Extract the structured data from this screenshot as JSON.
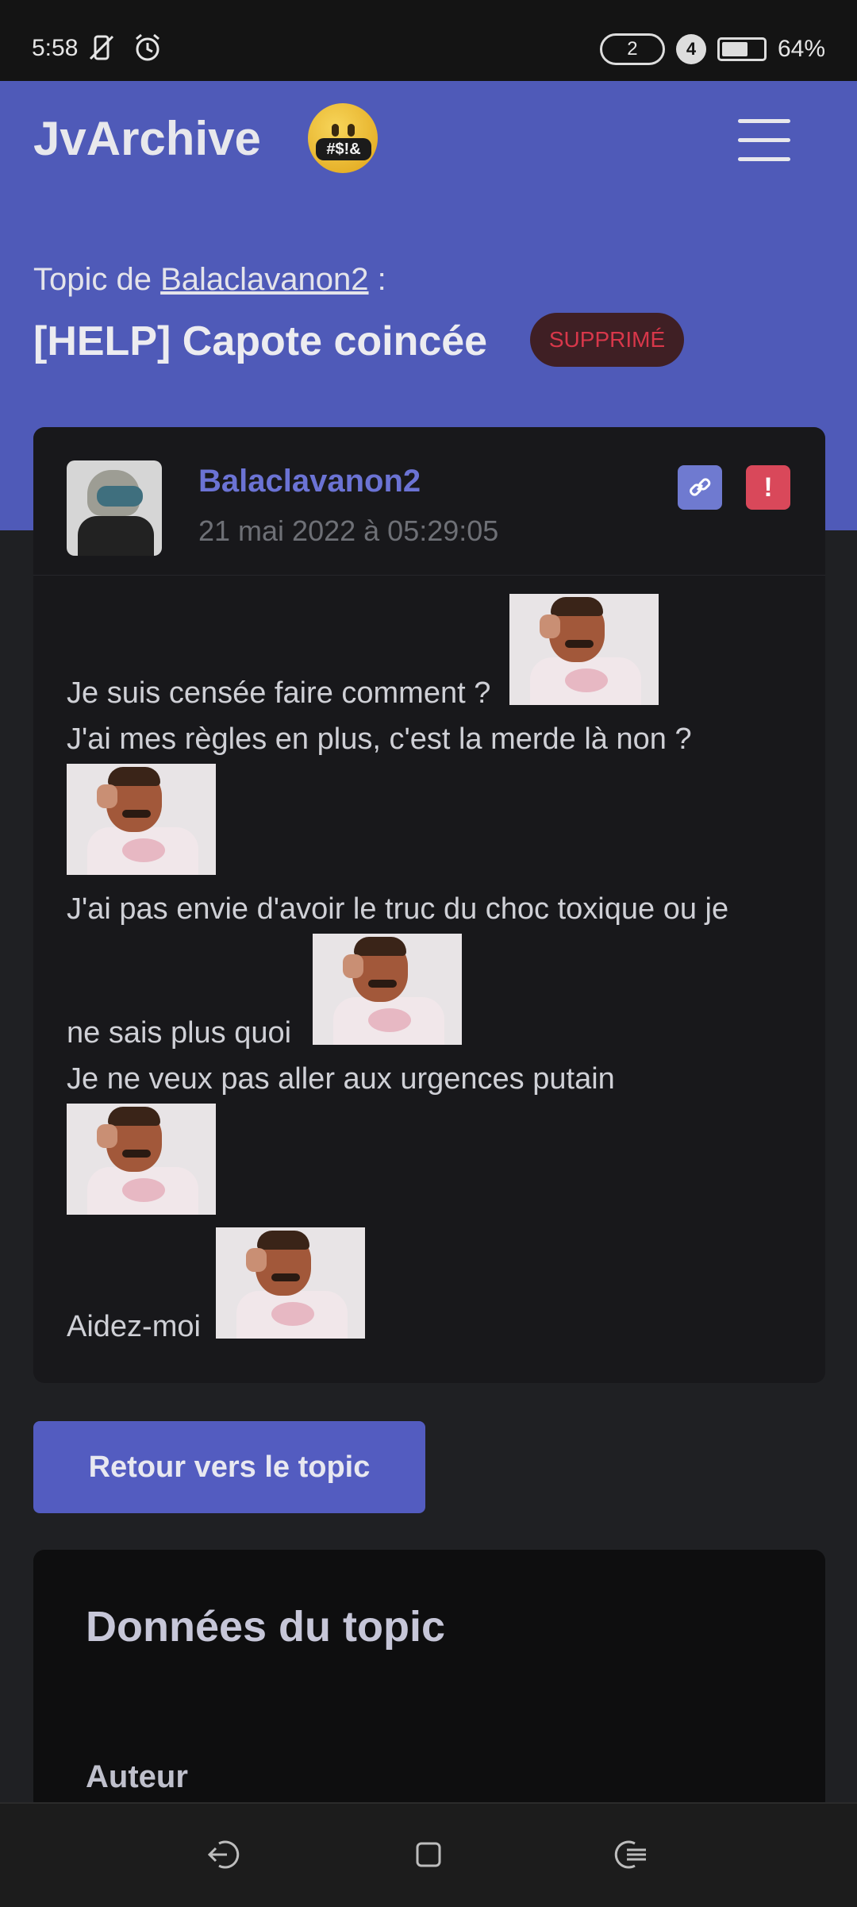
{
  "status_bar": {
    "time": "5:58",
    "sim_label": "2",
    "network_label": "4",
    "battery": "64%",
    "battery_level": 0.64
  },
  "header": {
    "brand": "JvArchive",
    "emoji_text": "#$!&",
    "topic_prefix": "Topic de",
    "topic_author": "Balaclavanon2",
    "topic_suffix": " :",
    "topic_title": "[HELP] Capote coincée",
    "deleted_badge": "SUPPRIMÉ"
  },
  "post": {
    "author": "Balaclavanon2",
    "date": "21 mai 2022 à 05:29:05",
    "lines": [
      "Je suis censée faire comment ?",
      "J'ai mes règles en plus, c'est la merde là non ?",
      "J'ai pas envie d'avoir le truc du choc toxique ou je",
      "ne sais plus quoi",
      "Je ne veux pas aller aux urgences putain",
      "Aidez-moi"
    ]
  },
  "actions": {
    "back_to_topic": "Retour vers le topic"
  },
  "topic_data": {
    "title": "Données du topic",
    "author_label": "Auteur"
  },
  "colors": {
    "header_bg": "#4f5ab8",
    "accent": "#6b73d4",
    "danger": "#d9485a",
    "page_bg": "#1f2023"
  },
  "icons": {
    "menu": "hamburger-menu-icon",
    "link": "link-icon",
    "report": "exclamation-icon",
    "nav_back": "back-icon",
    "nav_home": "home-icon",
    "nav_recent": "recent-apps-icon"
  }
}
